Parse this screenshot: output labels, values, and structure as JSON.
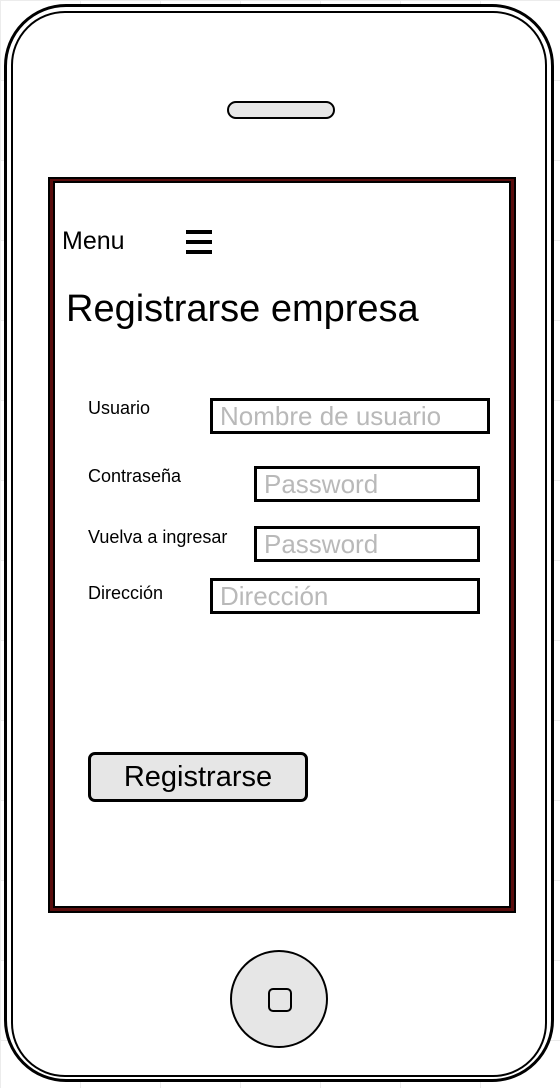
{
  "header": {
    "menu_label": "Menu"
  },
  "page": {
    "title": "Registrarse empresa"
  },
  "form": {
    "fields": [
      {
        "label": "Usuario",
        "placeholder": "Nombre de usuario",
        "value": ""
      },
      {
        "label": "Contraseña",
        "placeholder": "Password",
        "value": ""
      },
      {
        "label": "Vuelva a ingresar",
        "placeholder": "Password",
        "value": ""
      },
      {
        "label": "Dirección",
        "placeholder": "Dirección",
        "value": ""
      }
    ],
    "submit_label": "Registrarse"
  },
  "colors": {
    "screen_border": "#5a0d0d",
    "button_fill": "#e6e6e6",
    "placeholder_text": "#b9b9b9"
  },
  "icons": {
    "menu": "hamburger-icon",
    "home": "home-button-icon",
    "speaker": "speaker-grille"
  }
}
